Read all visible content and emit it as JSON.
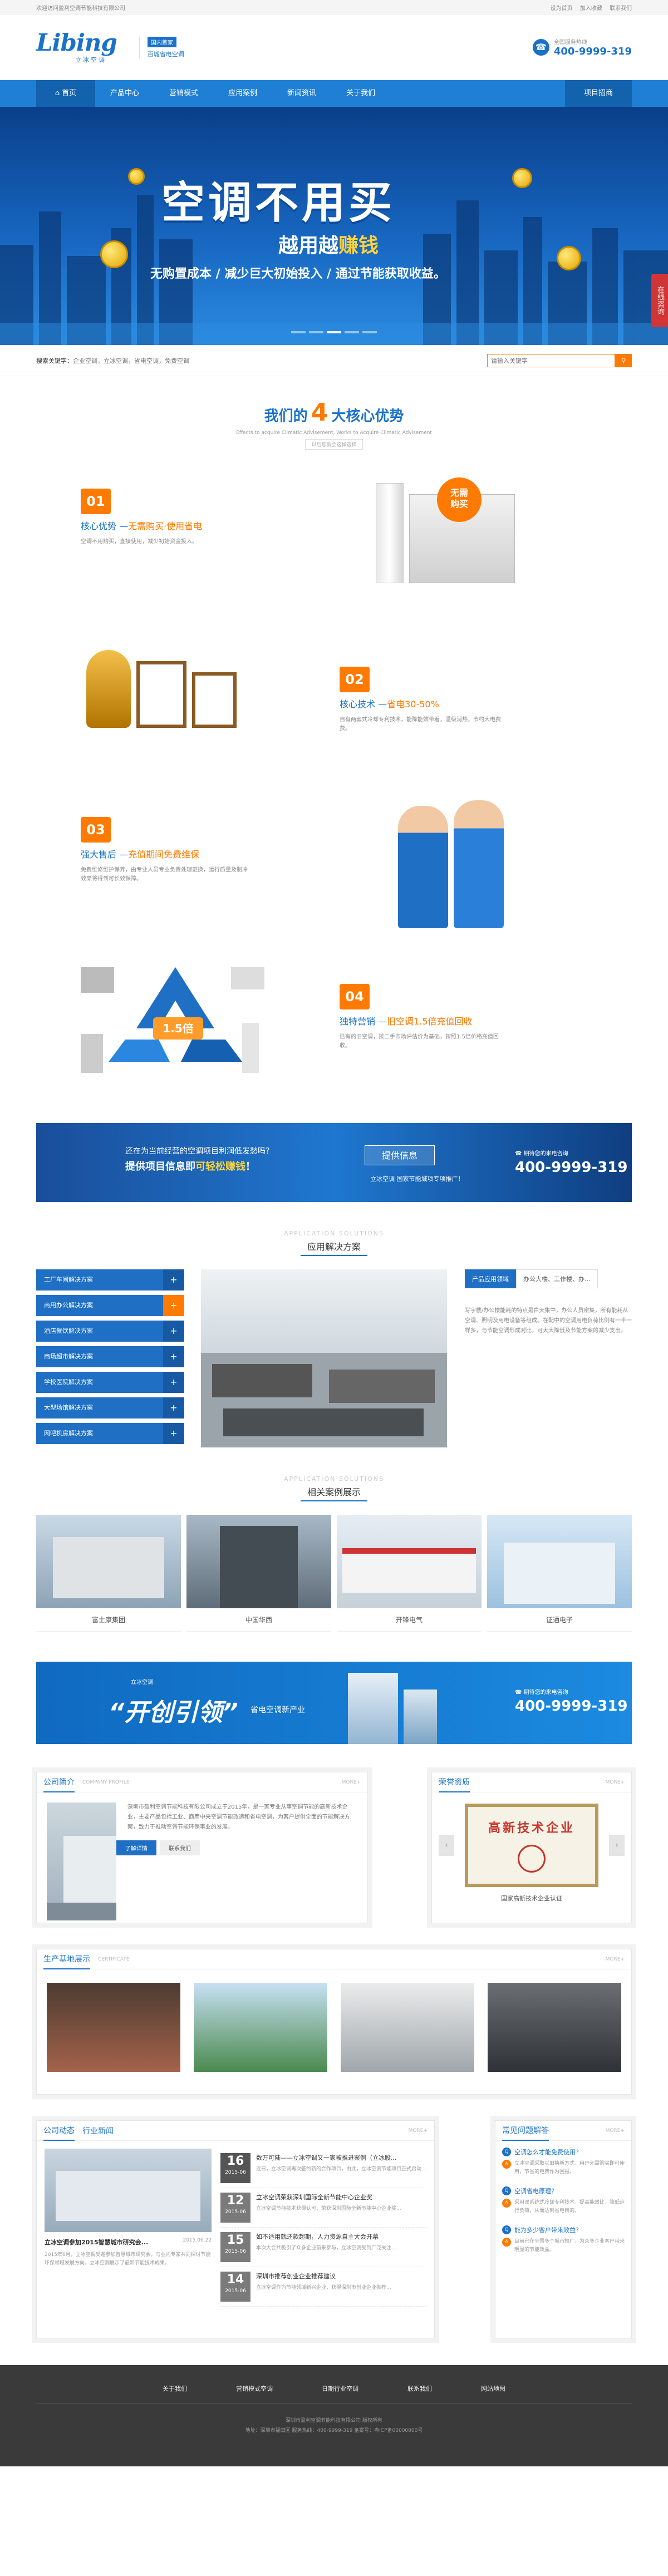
{
  "topbar": {
    "welcome": "欢迎访问盈利空调节能科技有限公司",
    "links": [
      "设为首页",
      "加入收藏",
      "联系我们"
    ]
  },
  "header": {
    "logo_text": "Libing",
    "logo_sub": "立冰空调",
    "tag": "国内首家",
    "slogan": "百城省电空调",
    "hotline_label": "全国服务热线",
    "hotline": "400-9999-319"
  },
  "nav": {
    "items": [
      "首页",
      "产品中心",
      "营销模式",
      "应用案例",
      "新闻资讯",
      "关于我们",
      "项目招商"
    ]
  },
  "banner": {
    "title": "空调不用买",
    "sub_a": "越用越",
    "sub_b": "赚钱",
    "sub2": "无购置成本 / 减少巨大初始投入 / 通过节能获取收益。",
    "side": "在线咨询"
  },
  "hotsearch": {
    "label": "搜索关键字：",
    "keywords": "企业空调，立冰空调，省电空调，免费空调",
    "placeholder": "请输入关键字"
  },
  "advantages": {
    "title_a": "我们的",
    "title_num": "4",
    "title_b": "大核心优势",
    "en": "Effects to acquire Climatic Advisement, Works to Acquire Climatic Advisement",
    "en2": "以后您就会这样选择",
    "items": [
      {
        "num": "01",
        "h1": "核心优势 —",
        "h2": "无需购买·使用省电",
        "d": "空调不用购买，直接使用，减少初始资金投入。",
        "badge1": "无需",
        "badge2": "购买"
      },
      {
        "num": "02",
        "h1": "核心技术 —",
        "h2": "省电30-50%",
        "d": "自有两套式冷却专利技术，能降能效带着，温级消热，节约大电费费。"
      },
      {
        "num": "03",
        "h1": "强大售后 —",
        "h2": "充值期间免费维保",
        "d": "免费维修维护保养，由专业人员专业负责处理更换，运行质量及制冷效果将得到可长效保障。"
      },
      {
        "num": "04",
        "h1": "独特营销 —",
        "h2": "旧空调1.5倍充值回收",
        "d": "已有的旧空调，按二手市场评估价为基础，按照1.5倍价格充值回收。",
        "badge": "1.5倍"
      }
    ]
  },
  "promo": {
    "q1": "还在为当前经营的空调项目利润低发愁吗？",
    "q2a": "提供项目信息即",
    "q2b": "可轻松赚钱",
    "q2c": "！",
    "button": "提供信息",
    "q3": "立冰空调 国家节能城项专项推广！",
    "tel_label": "期待您的来电咨询",
    "tel": "400-9999-319"
  },
  "solutions": {
    "en": "APPLICATION SOLUTIONS",
    "cn": "应用解决方案",
    "items": [
      "工厂车间解决方案",
      "商用办公解决方案",
      "酒店餐饮解决方案",
      "商场超市解决方案",
      "学校医院解决方案",
      "大型场馆解决方案",
      "网吧机房解决方案"
    ],
    "tabs": [
      "产品应用领域",
      "办公大楼、工作楼、办..."
    ],
    "desc": "写字楼/办公楼能耗的特点是白天集中，办公人员密集，所有能耗从空调、照明及用电设备等组成。在配中的空调用电负荷比例有一半一样多，与节能空调形成对比，可大大降低及节能方案的减少支出。"
  },
  "cases": {
    "en": "APPLICATION SOLUTIONS",
    "cn": "相关案例展示",
    "items": [
      "富士康集团",
      "中国华西",
      "开锋电气",
      "证通电子"
    ]
  },
  "promo2": {
    "top": "立冰空调",
    "big": "“开创引领”",
    "small": "省电空调新产业",
    "tel_label": "期待您的来电咨询",
    "tel": "400-9999-319"
  },
  "company": {
    "cn": "公司简介",
    "en": "COMPANY PROFILE",
    "more": "MORE+",
    "text": "深圳市盈利空调节能科技有限公司成立于2015年，是一家专业从事空调节能的高新技术企业，主要产品包括工业、商用中央空调节能改造和省电空调，为客户提供全面的节能解决方案，致力于推动空调节能环保事业的发展。",
    "btn1": "了解详情",
    "btn2": "联系我们"
  },
  "honor": {
    "cn": "荣誉资质",
    "more": "MORE+",
    "cert_title": "高新技术企业",
    "caption": "国家高新技术企业认证"
  },
  "base": {
    "cn": "生产基地展示",
    "en": "CERTIFICATE",
    "more": "MORE+"
  },
  "news": {
    "cn1": "公司动态",
    "cn2": "行业新闻",
    "more": "MORE+",
    "headline": "立冰空调参加2015智慧城市研究会...",
    "headline_date": "2015.06.22",
    "headline_desc": "2015年6月，立冰空调受邀参加智慧城市研究会，与业内专家共同探讨节能环保领域发展方向，立冰空调展示了最新节能技术成果。",
    "items": [
      {
        "dd": "16",
        "ym": "2015-06",
        "t": "数万可陆——立冰空调又一家被推进案例（立冰股...",
        "s": "近日，立冰空调再次签约新的合作项目，由此，立冰空调节能项目正式启动..."
      },
      {
        "dd": "12",
        "ym": "2015-06",
        "t": "立冰空调荣获深圳国际全新节能中心企业奖",
        "s": "立冰空调节能技术获得认可，荣获深圳国际全新节能中心企业奖..."
      },
      {
        "dd": "15",
        "ym": "2015-06",
        "t": "如不适用就还款超期，人力资源自主大会开幕",
        "s": "本次大会共吸引了众多企业前来参与，立冰空调受到广泛关注..."
      },
      {
        "dd": "14",
        "ym": "2015-06",
        "t": "深圳市推荐创业企业推荐建议",
        "s": "立冰空调作为节能领域新兴企业，获得深圳市创业企业推荐..."
      }
    ]
  },
  "faq": {
    "cn": "常见问题解答",
    "more": "MORE+",
    "items": [
      {
        "q": "空调怎么才能免费使用？",
        "a": "立冰空调采取以旧换新方式，用户无需购买即可使用，节省的电费作为回报。"
      },
      {
        "q": "空调省电原理？",
        "a": "采用双系统式冷却专利技术，提高能效比，降低运行负荷，从而达到省电目的。"
      },
      {
        "q": "能为多少客户带来效益？",
        "a": "目前已在全国多个城市推广，为众多企业客户带来明显的节能效益。"
      }
    ]
  },
  "footer": {
    "links": [
      "关于我们",
      "营销模式空调",
      "日期行业空调",
      "联系我们",
      "网站地图"
    ],
    "copy1": "深圳市盈利空调节能科技有限公司 版权所有",
    "copy2": "地址：深圳市福田区 服务热线：400-9999-319 备案号：粤ICP备00000000号"
  },
  "colors": {
    "primary": "#1f7fd4",
    "accent": "#ff7a00",
    "footer": "#3a3a3a"
  }
}
